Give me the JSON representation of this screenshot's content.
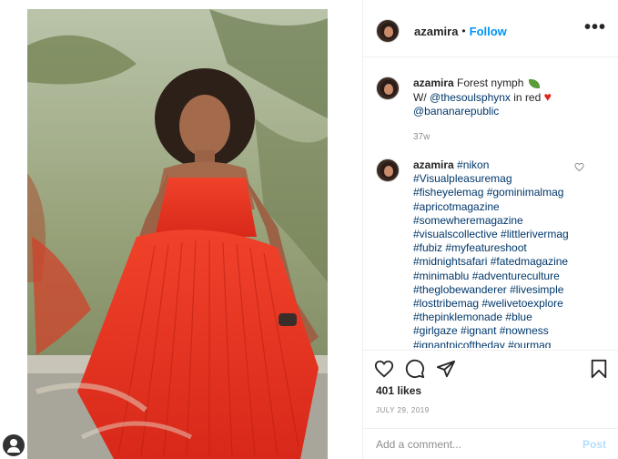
{
  "post": {
    "author": "azamira",
    "separator": "•",
    "follow_label": "Follow",
    "more_label": "•••"
  },
  "caption": {
    "username": "azamira",
    "text_1": "Forest nymph",
    "text_2": "W/",
    "mention_1": "@thesoulsphynx",
    "text_3": "in red",
    "mention_2": "@bananarepublic",
    "time": "37w"
  },
  "hashtag_comment": {
    "username": "azamira",
    "tags": [
      "#nikon",
      "#Visualpleasuremag",
      "#fisheyelemag #gominimalmag",
      "#apricotmagazine",
      "#somewheremagazine",
      "#visualscollective #littlerivermag",
      "#fubiz #myfeatureshoot",
      "#midnightsafari #fatedmagazine",
      "#minimablu #adventureculture",
      "#theglobewanderer #livesimple",
      "#losttribemag #welivetoexplore",
      "#thepinklemonade #blue",
      "#girlgaze #ignant #nowness",
      "#ignantpicoftheday #ourmag"
    ]
  },
  "engagement": {
    "likes": "401 likes",
    "date": "JULY 29, 2019"
  },
  "composer": {
    "placeholder": "Add a comment...",
    "post_label": "Post"
  },
  "icons": {
    "like": "heart-icon",
    "comment": "comment-icon",
    "share": "share-icon",
    "save": "bookmark-icon",
    "profile": "profile-icon"
  },
  "colors": {
    "link": "#0095f6",
    "hashtag": "#00376b",
    "post_disabled": "#b2dffc",
    "dress": "#e8361f"
  }
}
